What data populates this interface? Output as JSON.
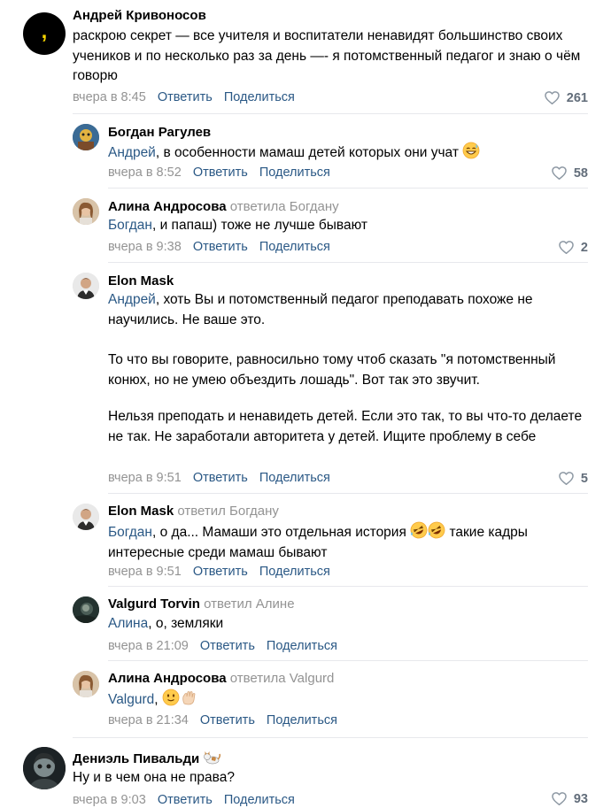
{
  "comments": [
    {
      "author": "Андрей Кривоносов",
      "text": "раскрою секрет — все учителя и воспитатели ненавидят большинство своих учеников и по несколько раз за день —- я потомственный педагог и знаю о чём говорю",
      "time": "вчера в 8:45",
      "reply": "Ответить",
      "share": "Поделиться",
      "likes": "261"
    },
    {
      "author": "Богдан Рагулев",
      "mention": "Андрей",
      "text": ", в особенности мамаш детей которых они учат",
      "time": "вчера в 8:52",
      "reply": "Ответить",
      "share": "Поделиться",
      "likes": "58"
    },
    {
      "author": "Алина Андросова",
      "reply_to": "ответила Богдану",
      "mention": "Богдан",
      "text": ", и папаш) тоже не лучше бывают",
      "time": "вчера в 9:38",
      "reply": "Ответить",
      "share": "Поделиться",
      "likes": "2"
    },
    {
      "author": "Elon Mask",
      "mention": "Андрей",
      "text1": ", хоть Вы и потомственный педагог преподавать похоже не научились. Не ваше это.",
      "text2": "То что вы говорите, равносильно тому чтоб сказать \"я потомственный конюх, но не умею объездить лошадь\". Вот так это звучит.",
      "text3": "Нельзя преподать и ненавидеть детей. Если это так, то вы что-то делаете не так. Не заработали авторитета у детей. Ищите проблему в себе",
      "time": "вчера в 9:51",
      "reply": "Ответить",
      "share": "Поделиться",
      "likes": "5"
    },
    {
      "author": "Elon Mask",
      "reply_to": "ответил Богдану",
      "mention": "Богдан",
      "text_a": ", о да... Мамаши это отдельная история",
      "text_b": "такие кадры интересные среди мамаш бывают",
      "time": "вчера в 9:51",
      "reply": "Ответить",
      "share": "Поделиться"
    },
    {
      "author": "Valgurd Torvin",
      "reply_to": "ответил Алине",
      "mention": "Алина",
      "text": ", о, земляки",
      "time": "вчера в 21:09",
      "reply": "Ответить",
      "share": "Поделиться"
    },
    {
      "author": "Алина Андросова",
      "reply_to": "ответила Valgurd",
      "mention": "Valgurd",
      "text": ",",
      "time": "вчера в 21:34",
      "reply": "Ответить",
      "share": "Поделиться"
    },
    {
      "author": "Дениэль Пивальди",
      "text": "Ну и в чем она не права?",
      "time": "вчера в 9:03",
      "reply": "Ответить",
      "share": "Поделиться",
      "likes": "93"
    }
  ],
  "colors": {
    "link": "#2a5885",
    "muted": "#939393",
    "divider": "#e7e8ec"
  },
  "icons": [
    "heart-icon",
    "grin-sweat-emoji",
    "rofl-emoji",
    "smile-emoji",
    "wave-hand-emoji",
    "cat-emoji"
  ]
}
